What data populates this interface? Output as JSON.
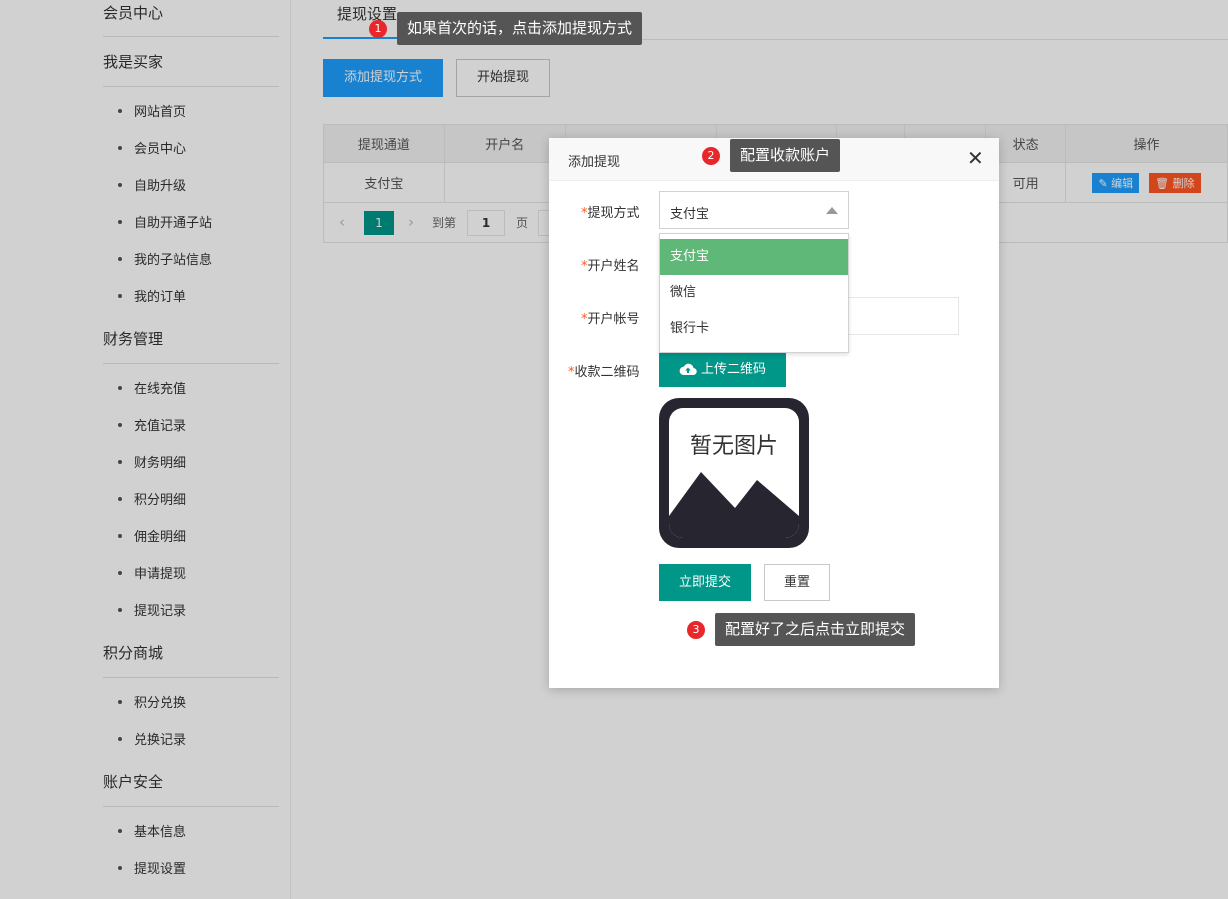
{
  "sidebar": {
    "groups": [
      {
        "title": "会员中心"
      },
      {
        "title": "我是买家",
        "items": [
          "网站首页",
          "会员中心",
          "自助升级",
          "自助开通子站",
          "我的子站信息",
          "我的订单"
        ]
      },
      {
        "title": "财务管理",
        "items": [
          "在线充值",
          "充值记录",
          "财务明细",
          "积分明细",
          "佣金明细",
          "申请提现",
          "提现记录"
        ]
      },
      {
        "title": "积分商城",
        "items": [
          "积分兑换",
          "兑换记录"
        ]
      },
      {
        "title": "账户安全",
        "items": [
          "基本信息",
          "提现设置"
        ]
      }
    ]
  },
  "main": {
    "tab": "提现设置",
    "buttons": {
      "add": "添加提现方式",
      "start": "开始提现"
    },
    "table": {
      "headers": [
        "提现通道",
        "开户名",
        "",
        "",
        "",
        "",
        "状态",
        "操作"
      ],
      "row": {
        "channel": "支付宝",
        "status": "可用",
        "edit": "编辑",
        "delete": "删除"
      }
    },
    "pager": {
      "current": "1",
      "goto": "到第",
      "page_input": "1",
      "page": "页"
    }
  },
  "dialog": {
    "title": "添加提现",
    "fields": {
      "method_label": "提现方式",
      "name_label": "开户姓名",
      "account_label": "开户帐号",
      "qrcode_label": "收款二维码",
      "required_mark": "*"
    },
    "select_value": "支付宝",
    "options": [
      "支付宝",
      "微信",
      "银行卡"
    ],
    "upload_button": "上传二维码",
    "no_image_text": "暂无图片",
    "submit_button": "立即提交",
    "reset_button": "重置"
  },
  "tips": [
    {
      "num": "1",
      "text": "如果首次的话，点击添加提现方式"
    },
    {
      "num": "2",
      "text": "配置收款账户"
    },
    {
      "num": "3",
      "text": "配置好了之后点击立即提交"
    }
  ],
  "colors": {
    "primary": "#1E9FFF",
    "teal": "#009688",
    "green": "#5FB878",
    "danger": "#FF5722",
    "tip_badge": "#e8272b"
  }
}
